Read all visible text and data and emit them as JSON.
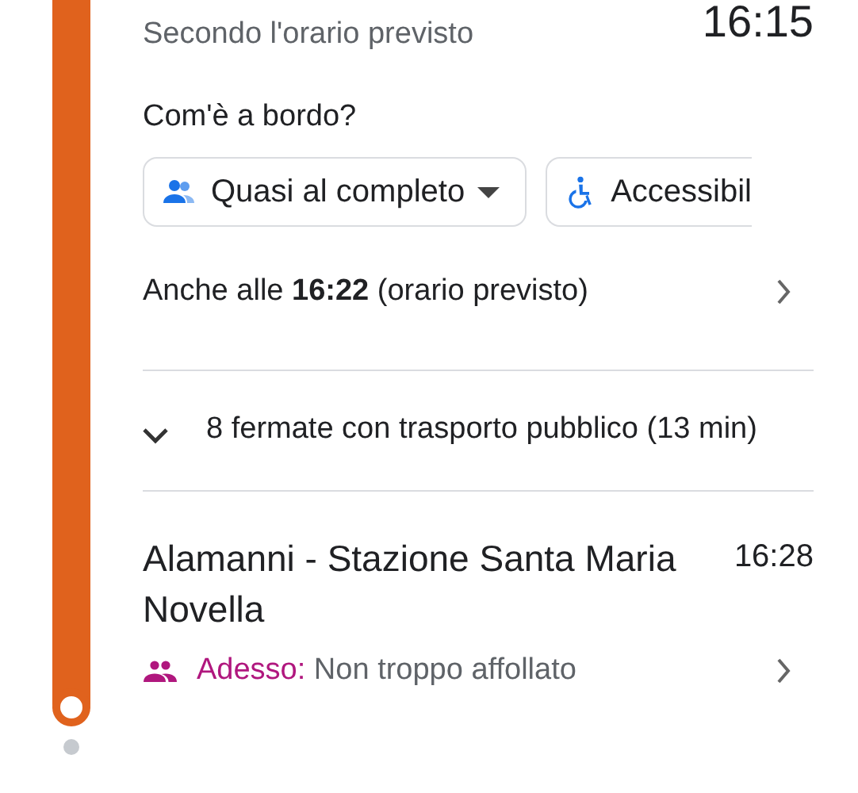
{
  "departure": {
    "time": "16:15",
    "note": "Secondo l'orario previsto"
  },
  "occupancy": {
    "question": "Com'è a bordo?",
    "chips": [
      {
        "kind": "dropdown",
        "label": "Quasi al completo"
      },
      {
        "kind": "accessibility",
        "label": "Accessibil"
      }
    ]
  },
  "alternative": {
    "text": "Anche alle **16:22** (orario previsto)"
  },
  "stops": {
    "label": "8 fermate con trasporto pubblico (13 min)",
    "expanded": false
  },
  "arrival": {
    "name": "Alamanni - Stazione Santa Maria Novella",
    "time": "16:28",
    "crowd_label": "Adesso:",
    "crowd_status": "Non troppo affollato"
  }
}
